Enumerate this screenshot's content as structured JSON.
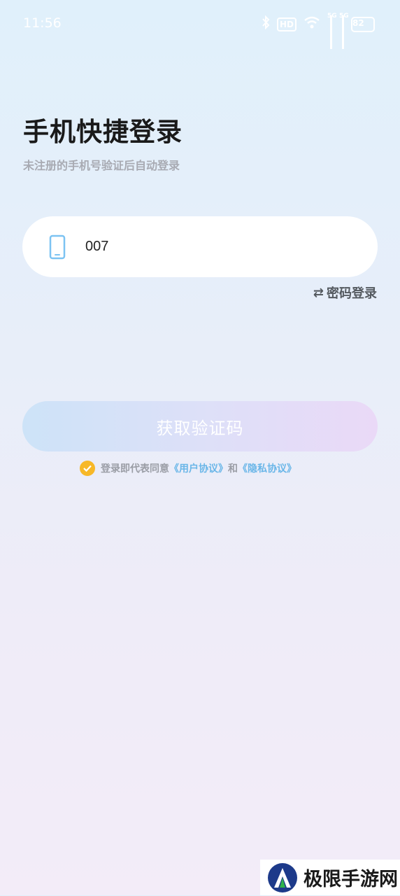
{
  "status_bar": {
    "time": "11:56",
    "hd_label": "HD",
    "net1": "5G",
    "net2": "5G",
    "battery": "82",
    "icons": [
      "bluetooth-icon",
      "wifi-icon",
      "signal-icon",
      "signal-icon",
      "battery-icon"
    ]
  },
  "header": {
    "title": "手机快捷登录",
    "subtitle": "未注册的手机号验证后自动登录"
  },
  "phone_input": {
    "value": "007",
    "icon": "phone-icon"
  },
  "password_login": {
    "icon": "switch-icon",
    "label": "密码登录"
  },
  "get_code_button": {
    "label": "获取验证码"
  },
  "agreement": {
    "checked": true,
    "prefix": "登录即代表同意",
    "user_agreement": "《用户协议》",
    "conjunction": "和",
    "privacy_policy": "《隐私协议》"
  },
  "watermark": {
    "text": "极限手游网"
  },
  "colors": {
    "accent_link": "#6ab6e8",
    "check": "#f7b828",
    "phone_icon": "#7cc3f2"
  }
}
